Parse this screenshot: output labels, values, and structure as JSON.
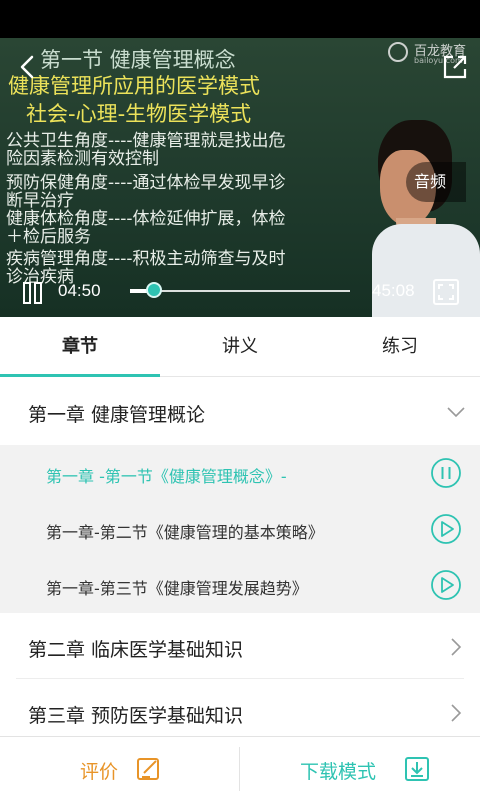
{
  "video": {
    "board_lines": {
      "title": "第一节  健康管理概念",
      "yellow_1": "健康管理所应用的医学模式",
      "yellow_2": "社会-心理-生物医学模式",
      "white": [
        "公共卫生角度----健康管理就是找出危",
        "险因素检测有效控制",
        "预防保健角度----通过体检早发现早诊",
        "断早治疗",
        "健康体检角度----体检延伸扩展，体检",
        "＋检后服务",
        "疾病管理角度----积极主动筛查与及时",
        "诊治疾病"
      ]
    },
    "logo_text": "百龙教育",
    "logo_sub": "bailoyu.com",
    "audio_label": "音频",
    "current_time": "04:50",
    "duration": "45:08",
    "progress_fraction": 0.107
  },
  "tabs": [
    {
      "label": "章节",
      "active": true
    },
    {
      "label": "讲义",
      "active": false
    },
    {
      "label": "练习",
      "active": false
    }
  ],
  "chapters": [
    {
      "title": "第一章    健康管理概论",
      "expanded": true,
      "lessons": [
        {
          "title": "第一章 -第一节《健康管理概念》-",
          "state": "playing"
        },
        {
          "title": "第一章-第二节《健康管理的基本策略》",
          "state": "idle"
        },
        {
          "title": "第一章-第三节《健康管理发展趋势》",
          "state": "idle"
        }
      ]
    },
    {
      "title": "第二章  临床医学基础知识",
      "expanded": false
    },
    {
      "title": "第三章  预防医学基础知识",
      "expanded": false
    }
  ],
  "bottom": {
    "review_label": "评价",
    "download_label": "下载模式"
  },
  "colors": {
    "accent": "#2ec3b2",
    "review": "#e89428"
  },
  "icons": [
    "back-icon",
    "share-icon",
    "pause-icon",
    "fullscreen-icon",
    "chevron-down-icon",
    "chevron-right-icon",
    "play-circle-icon",
    "pause-circle-icon",
    "edit-icon",
    "download-icon"
  ]
}
